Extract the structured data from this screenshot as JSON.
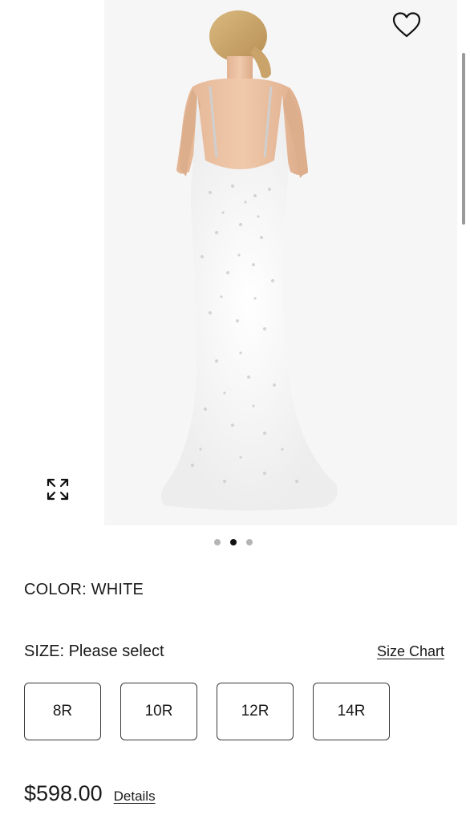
{
  "product": {
    "image_alt": "White sequin backless gown, back view",
    "image_count": 3,
    "active_image_index": 1
  },
  "color": {
    "label": "COLOR: WHITE"
  },
  "size": {
    "label": "SIZE:",
    "value": "Please select",
    "chart_link": "Size Chart",
    "options": [
      "8R",
      "10R",
      "12R",
      "14R"
    ]
  },
  "price": {
    "amount": "$598.00",
    "details_link": "Details"
  },
  "icons": {
    "favorite": "heart-icon",
    "expand": "expand-arrows-icon"
  }
}
